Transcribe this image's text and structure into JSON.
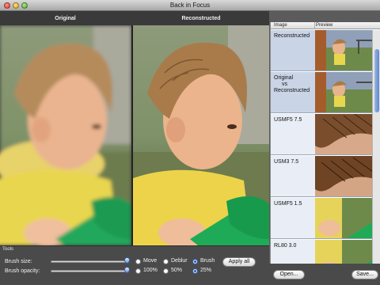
{
  "window": {
    "title": "Back in Focus"
  },
  "panes": {
    "original_label": "Original",
    "reconstructed_label": "Reconstructed"
  },
  "list": {
    "headers": {
      "image": "Image",
      "preview": "Preview"
    },
    "items": [
      {
        "label": "Reconstructed"
      },
      {
        "label_lines": [
          "Original",
          "vs",
          "Reconstructed"
        ]
      },
      {
        "label": "USMF5 7.5"
      },
      {
        "label": "USM3 7.5"
      },
      {
        "label": "USMF5 1.5"
      },
      {
        "label": "RL80 3.0"
      }
    ]
  },
  "tools": {
    "section_label": "Tools",
    "brush_size_label": "Brush size:",
    "brush_opacity_label": "Brush opacity:",
    "brush_size_value": 1.0,
    "brush_opacity_value": 1.0,
    "modes": {
      "move": "Move",
      "deblur": "Deblur",
      "brush": "Brush",
      "selected": "Brush"
    },
    "opacity_options": {
      "o100": "100%",
      "o50": "50%",
      "o25": "25%",
      "selected": "25%"
    },
    "apply_all": "Apply all"
  },
  "buttons": {
    "open": "Open...",
    "save": "Save..."
  },
  "colors": {
    "tools_bg": "#4a4a4a",
    "selection": "#c9d4e6",
    "accent": "#5a86cc"
  }
}
